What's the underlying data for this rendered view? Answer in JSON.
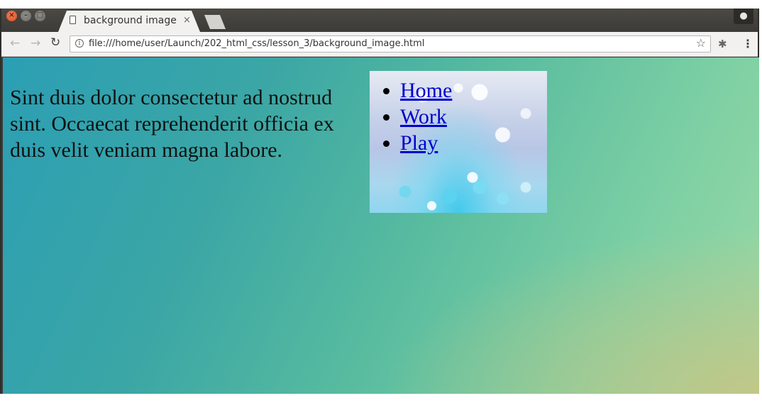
{
  "browser": {
    "tab_title": "background image",
    "tab_close": "×",
    "url": "file:///home/user/Launch/202_html_css/lesson_3/background_image.html"
  },
  "page": {
    "paragraph": "Sint duis dolor consectetur ad nostrud sint. Occaecat reprehenderit officia ex duis velit veniam magna labore.",
    "nav": [
      {
        "label": "Home"
      },
      {
        "label": "Work"
      },
      {
        "label": "Play"
      }
    ]
  },
  "colors": {
    "link": "#0000cc",
    "bg_start": "#2b9fb4",
    "bg_end": "#9bd8a6"
  }
}
